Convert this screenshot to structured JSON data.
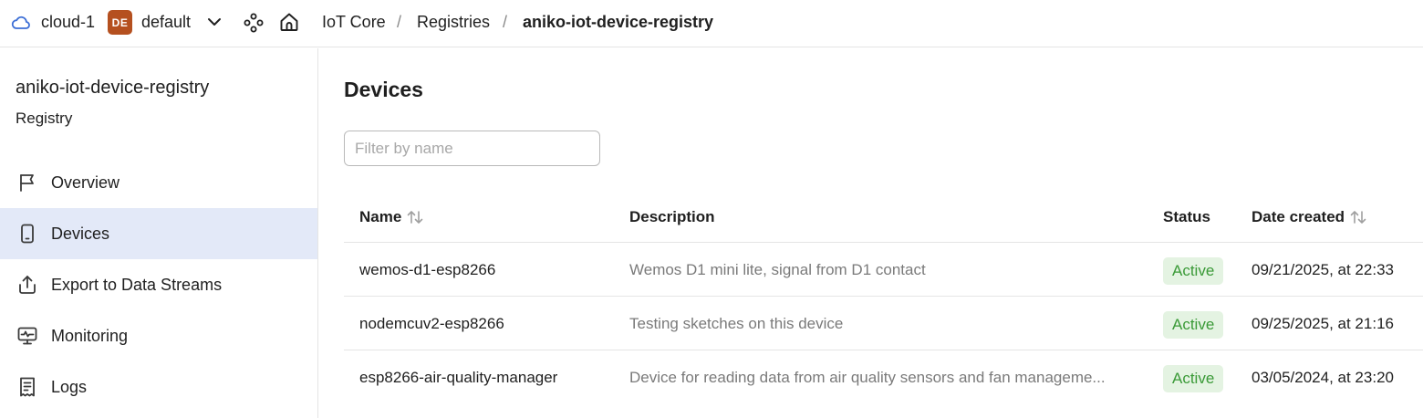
{
  "topbar": {
    "cloud_label": "cloud-1",
    "folder_badge": "DE",
    "folder_label": "default",
    "breadcrumb": [
      "IoT Core",
      "Registries",
      "aniko-iot-device-registry"
    ],
    "separator": "/"
  },
  "sidebar": {
    "title": "aniko-iot-device-registry",
    "subtitle": "Registry",
    "items": [
      {
        "label": "Overview",
        "icon": "flag-icon"
      },
      {
        "label": "Devices",
        "icon": "phone-icon",
        "active": true
      },
      {
        "label": "Export to Data Streams",
        "icon": "upload-icon"
      },
      {
        "label": "Monitoring",
        "icon": "monitor-icon"
      },
      {
        "label": "Logs",
        "icon": "receipt-icon"
      }
    ]
  },
  "main": {
    "title": "Devices",
    "filter_placeholder": "Filter by name",
    "columns": {
      "name": "Name",
      "description": "Description",
      "status": "Status",
      "date": "Date created"
    },
    "rows": [
      {
        "name": "wemos-d1-esp8266",
        "description": "Wemos D1 mini lite, signal from D1 contact",
        "status": "Active",
        "date": "09/21/2025, at 22:33"
      },
      {
        "name": "nodemcuv2-esp8266",
        "description": "Testing sketches on this device",
        "status": "Active",
        "date": "09/25/2025, at 21:16"
      },
      {
        "name": "esp8266-air-quality-manager",
        "description": "Device for reading data from air quality sensors and fan manageme...",
        "status": "Active",
        "date": "03/05/2024, at 23:20"
      }
    ]
  },
  "colors": {
    "accent_badge": "#b5501f",
    "active_nav": "#e3e9f8",
    "status_active_bg": "#e4f3e2",
    "status_active_text": "#3a9a37",
    "cloud_icon": "#3d6fd6"
  }
}
